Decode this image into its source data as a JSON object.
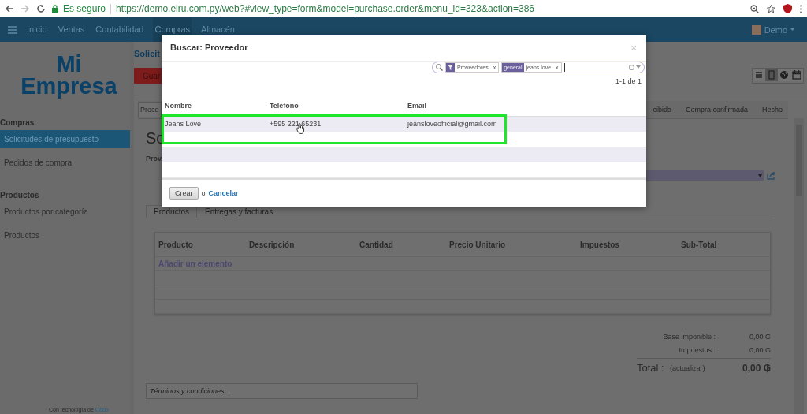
{
  "browser": {
    "security": "Es seguro",
    "url": "https://demo.eiru.com.py/web?#view_type=form&model=purchase.order&menu_id=323&action=386"
  },
  "navbar": {
    "menu": [
      {
        "label": "Inicio",
        "selected": false
      },
      {
        "label": "Ventas",
        "selected": false
      },
      {
        "label": "Contabilidad",
        "selected": false
      },
      {
        "label": "Compras",
        "selected": true
      },
      {
        "label": "Almacén",
        "selected": false
      }
    ],
    "user": "Demo"
  },
  "sidebar": {
    "logo": [
      "Mi",
      "Empresa"
    ],
    "sections": [
      {
        "title": "Compras",
        "items": [
          {
            "label": "Solicitudes de presupuesto",
            "selected": true
          },
          {
            "label": "Pedidos de compra",
            "selected": false
          }
        ]
      },
      {
        "title": "Productos",
        "items": [
          {
            "label": "Productos por categoría",
            "selected": false
          },
          {
            "label": "Productos",
            "selected": false
          }
        ]
      }
    ],
    "footer": {
      "text": "Con tecnología de",
      "link": "Odoo"
    }
  },
  "form": {
    "breadcrumb": "Solicit",
    "save_button": "Guar",
    "view_switcher": [
      {
        "kind": "list",
        "selected": false
      },
      {
        "kind": "form",
        "selected": true
      },
      {
        "kind": "map",
        "selected": false
      },
      {
        "kind": "calendar",
        "selected": false
      }
    ],
    "header_button": "Proce",
    "stages": [
      {
        "label": "cibida"
      },
      {
        "label": "Compra confirmada"
      },
      {
        "label": "Hecho"
      }
    ],
    "title": "So",
    "field_label": "Prov",
    "tabs": [
      {
        "label": "Productos",
        "selected": true
      },
      {
        "label": "Entregas y facturas",
        "selected": false
      }
    ],
    "lines": {
      "columns": [
        "Producto",
        "Descripción",
        "Cantidad",
        "Precio Unitario",
        "Impuestos",
        "Sub-Total"
      ],
      "add_link": "Añadir un elemento"
    },
    "totals": [
      {
        "label": "Base imponible :",
        "value": "0,00 ₲"
      },
      {
        "label": "Impuestos :",
        "value": "0,00 ₲"
      }
    ],
    "total": {
      "label": "Total :",
      "update": "(actualizar)",
      "value": "0,00 ₲"
    },
    "notes": {
      "placeholder": "Términos y condiciones..."
    }
  },
  "dialog": {
    "title": "Buscar: Proveedor",
    "close": "×",
    "facets": [
      {
        "kind": "filter",
        "value": "Proveedores",
        "remove": "x"
      },
      {
        "kind": "field",
        "label": "general",
        "value": "jeans love",
        "remove": "x"
      }
    ],
    "pager": "1-1 de 1",
    "columns": [
      "Nombre",
      "Teléfono",
      "Email"
    ],
    "rows": [
      {
        "cells": [
          "Jeans Love",
          "+595 221 65231",
          "jeansloveofficial@gmail.com"
        ]
      }
    ],
    "create_button": "Crear",
    "or": "o",
    "cancel_link": "Cancelar"
  }
}
